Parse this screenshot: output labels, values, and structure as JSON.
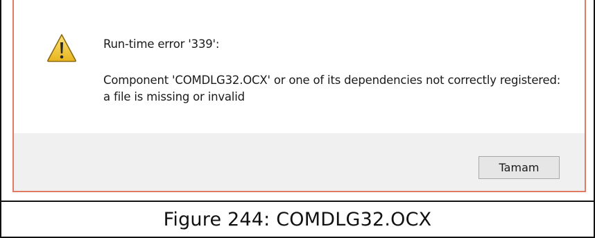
{
  "dialog": {
    "title": "Run-time error '339':",
    "message": "Component 'COMDLG32.OCX' or one of its dependencies not correctly registered: a file is missing or invalid",
    "icon": "warning-icon",
    "ok_button_label": "Tamam"
  },
  "caption": {
    "text": "Figure 244: COMDLG32.OCX"
  },
  "colors": {
    "dialog_border": "#e07a62",
    "footer_background": "#f0f0f0",
    "warning_fill": "#f3c52e",
    "warning_outline": "#8a6a14"
  }
}
